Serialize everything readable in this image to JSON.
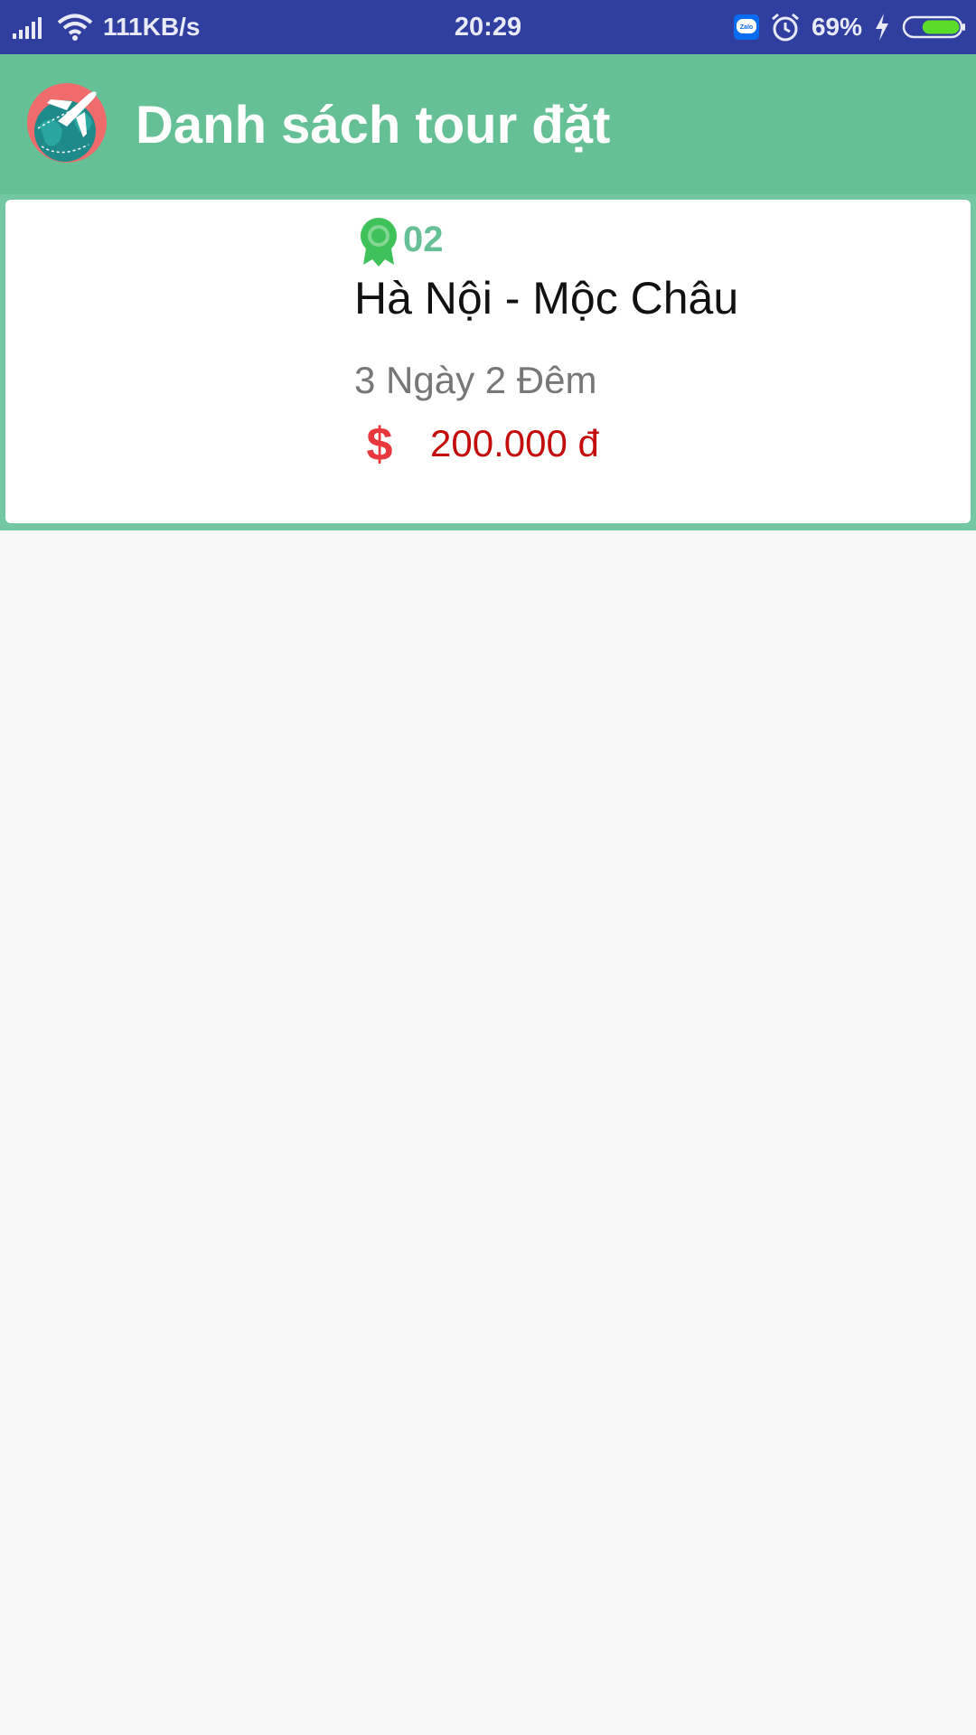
{
  "status_bar": {
    "net_speed": "111KB/s",
    "time": "20:29",
    "battery_percent": "69%",
    "battery_level": 0.69,
    "zalo_label": "Zalo",
    "icons": [
      "signal-icon",
      "wifi-icon",
      "zalo-icon",
      "alarm-icon",
      "charging-icon",
      "battery-icon"
    ],
    "colors": {
      "background": "#303e9f"
    }
  },
  "app_bar": {
    "title": "Danh sách tour đặt",
    "logo_icon": "globe-plane-icon",
    "colors": {
      "background": "#66c096"
    }
  },
  "bookings": [
    {
      "code": "02",
      "name": "Hà Nội - Mộc Châu",
      "duration": "3 Ngày 2 Đêm",
      "price": "200.000 đ",
      "badge_icon": "award-ribbon-icon",
      "price_icon": "dollar-icon"
    }
  ],
  "colors": {
    "accent": "#66c096",
    "price": "#c40c0c",
    "page_background": "#f8f8f8"
  }
}
